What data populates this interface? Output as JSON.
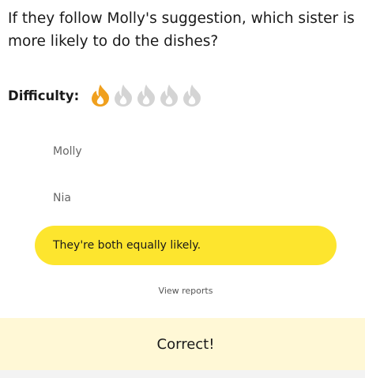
{
  "question": {
    "text": "If they follow Molly's suggestion, which sister is more likely to do the dishes?"
  },
  "difficulty": {
    "label": "Difficulty:",
    "level": 1,
    "max_level": 5,
    "icon": "flame-icon",
    "active_color": "#f0a01e",
    "inactive_color": "#d4d4d4"
  },
  "choices": [
    {
      "label": "Molly",
      "selected": false
    },
    {
      "label": "Nia",
      "selected": false
    },
    {
      "label": "They're both equally likely.",
      "selected": true
    }
  ],
  "colors": {
    "selected_choice": "#fde52e",
    "result_background": "#fff8d6"
  },
  "reports": {
    "label": "View reports"
  },
  "result": {
    "text": "Correct!"
  }
}
